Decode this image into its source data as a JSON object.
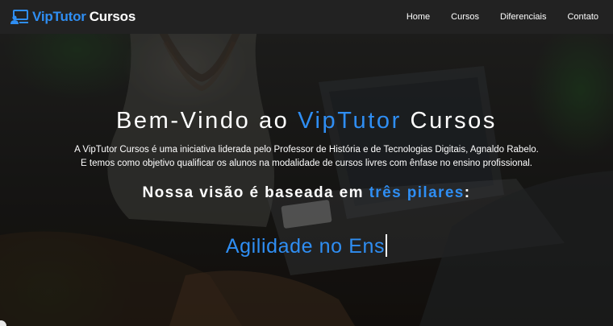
{
  "navbar": {
    "brand": {
      "name_accent": "VipTutor",
      "name_rest": "Cursos",
      "icon": "laptop-users-icon"
    },
    "links": [
      "Home",
      "Cursos",
      "Diferenciais",
      "Contato"
    ]
  },
  "hero": {
    "title_start": "Bem-Vindo ao ",
    "title_accent": "VipTutor",
    "title_end": " Cursos",
    "description_line1": "A VipTutor Cursos é uma iniciativa liderada pelo Professor de História e de Tecnologias Digitais, Agnaldo Rabelo.",
    "description_line2": "E temos como objetivo qualificar os alunos na modalidade de cursos livres com ênfase no ensino profissional.",
    "vision_start": "Nossa visão é baseada em ",
    "vision_accent": "três pilares",
    "vision_end": ":",
    "typing_text": "Agilidade no Ens"
  },
  "colors": {
    "accent": "#2f8ef3",
    "navbar_bg": "#222222",
    "text": "#ffffff"
  }
}
